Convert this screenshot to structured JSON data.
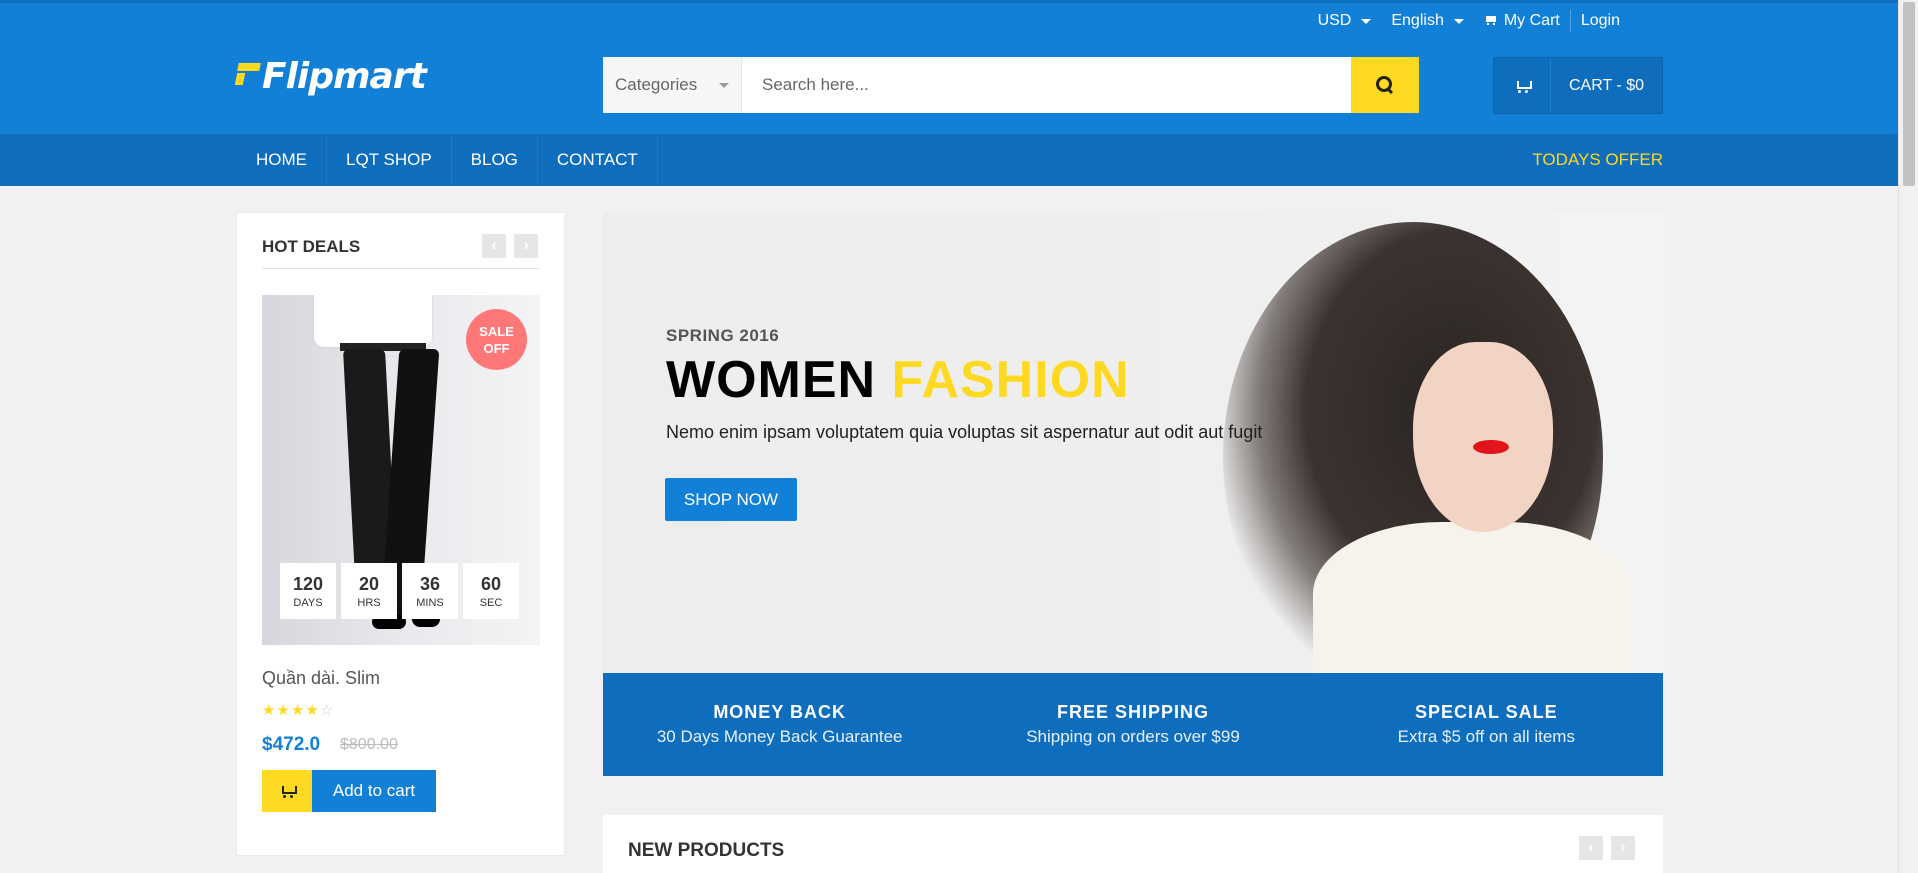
{
  "top_links": {
    "currency": "USD",
    "language": "English",
    "my_cart": "My Cart",
    "login": "Login"
  },
  "brand": {
    "name": "Flipmart",
    "colors": {
      "primary": "#1380d8",
      "dark": "#0f6dbd",
      "accent": "#fdd922"
    }
  },
  "search": {
    "category_label": "Categories",
    "placeholder": "Search here..."
  },
  "cart": {
    "label": "CART - $0"
  },
  "nav": {
    "items": [
      "HOME",
      "LQT SHOP",
      "BLOG",
      "CONTACT"
    ],
    "offer": "TODAYS OFFER"
  },
  "hot_deals": {
    "title": "HOT DEALS",
    "badge_line1": "SALE",
    "badge_line2": "OFF",
    "timer": [
      {
        "value": "120",
        "unit": "DAYS"
      },
      {
        "value": "20",
        "unit": "HRS"
      },
      {
        "value": "36",
        "unit": "MINS"
      },
      {
        "value": "60",
        "unit": "SEC"
      }
    ],
    "product_name": "Quần dài. Slim",
    "rating": 4,
    "rating_max": 5,
    "price": "$472.0",
    "old_price": "$800.00",
    "add_to_cart": "Add to cart"
  },
  "hero": {
    "subtitle": "SPRING 2016",
    "title_part1": "WOMEN",
    "title_part2": "FASHION",
    "text": "Nemo enim ipsam voluptatem quia voluptas sit aspernatur aut odit aut fugit",
    "button": "SHOP NOW"
  },
  "features": [
    {
      "title": "MONEY BACK",
      "desc": "30 Days Money Back Guarantee"
    },
    {
      "title": "FREE SHIPPING",
      "desc": "Shipping on orders over $99"
    },
    {
      "title": "SPECIAL SALE",
      "desc": "Extra $5 off on all items"
    }
  ],
  "new_products": {
    "title": "NEW PRODUCTS"
  }
}
